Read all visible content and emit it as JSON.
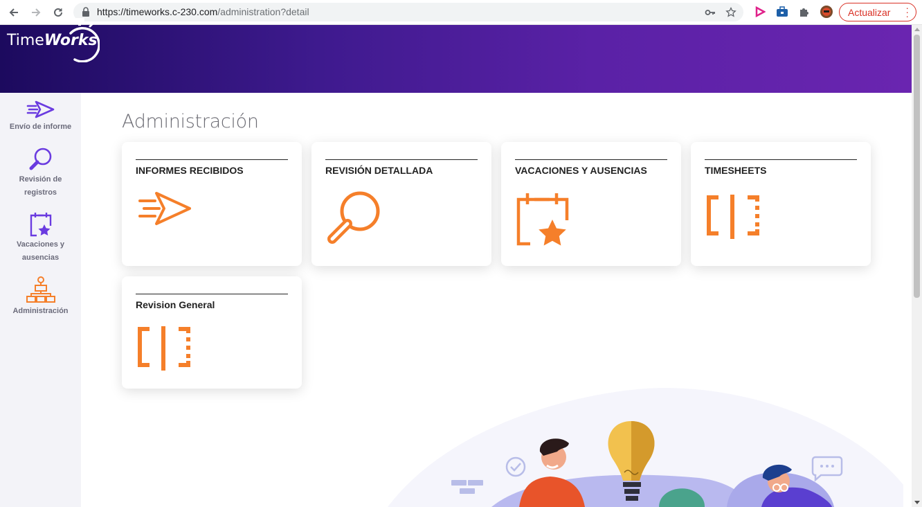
{
  "browser": {
    "url_host": "https://timeworks.c-230.com",
    "url_path": "/administration?detail",
    "update_label": "Actualizar"
  },
  "app": {
    "logo_text_1": "Time",
    "logo_text_2": "Works"
  },
  "sidebar": {
    "items": [
      {
        "label": "Envío de informe",
        "icon": "send-icon"
      },
      {
        "label": "Revisión de registros",
        "icon": "search-icon"
      },
      {
        "label": "Vacaciones y ausencias",
        "icon": "calendar-star-icon"
      },
      {
        "label": "Administración",
        "icon": "org-chart-icon"
      }
    ]
  },
  "main": {
    "title": "Administración",
    "cards": [
      {
        "label": "INFORMES RECIBIDOS",
        "icon": "send-icon"
      },
      {
        "label": "REVISIÓN DETALLADA",
        "icon": "search-icon"
      },
      {
        "label": "VACACIONES Y AUSENCIAS",
        "icon": "calendar-star-icon"
      },
      {
        "label": "TIMESHEETS",
        "icon": "timesheet-icon"
      },
      {
        "label": "Revision General",
        "icon": "timesheet-icon"
      }
    ]
  },
  "colors": {
    "accent_orange": "#f57f2a",
    "accent_purple": "#6a3be0",
    "header_start": "#1c0a5e",
    "header_end": "#6a25b0"
  }
}
